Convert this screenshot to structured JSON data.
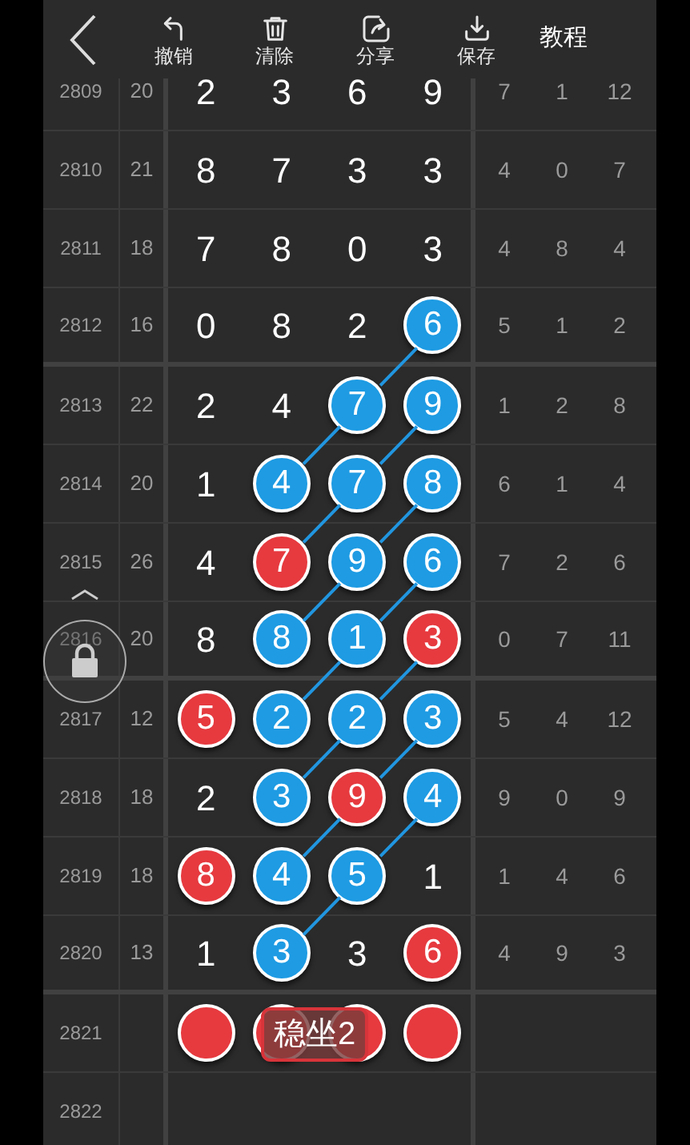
{
  "toolbar": {
    "actions": [
      {
        "kind": "undo",
        "label": "撤销"
      },
      {
        "kind": "trash",
        "label": "清除"
      },
      {
        "kind": "share",
        "label": "分享"
      },
      {
        "kind": "save",
        "label": "保存"
      }
    ],
    "tutorial": "教程"
  },
  "rows": [
    {
      "issue": "2809",
      "sum": "20",
      "cells": [
        {
          "text": "2",
          "kind": "plain"
        },
        {
          "text": "3",
          "kind": "plain"
        },
        {
          "text": "6",
          "kind": "plain"
        },
        {
          "text": "9",
          "kind": "plain"
        }
      ],
      "stats": [
        "7",
        "1",
        "12"
      ]
    },
    {
      "issue": "2810",
      "sum": "21",
      "cells": [
        {
          "text": "8",
          "kind": "plain"
        },
        {
          "text": "7",
          "kind": "plain"
        },
        {
          "text": "3",
          "kind": "plain"
        },
        {
          "text": "3",
          "kind": "plain"
        }
      ],
      "stats": [
        "4",
        "0",
        "7"
      ]
    },
    {
      "issue": "2811",
      "sum": "18",
      "cells": [
        {
          "text": "7",
          "kind": "plain"
        },
        {
          "text": "8",
          "kind": "plain"
        },
        {
          "text": "0",
          "kind": "plain"
        },
        {
          "text": "3",
          "kind": "plain"
        }
      ],
      "stats": [
        "4",
        "8",
        "4"
      ]
    },
    {
      "issue": "2812",
      "sum": "16",
      "cells": [
        {
          "text": "0",
          "kind": "plain"
        },
        {
          "text": "8",
          "kind": "plain"
        },
        {
          "text": "2",
          "kind": "plain"
        },
        {
          "text": "6",
          "kind": "blue"
        }
      ],
      "stats": [
        "5",
        "1",
        "2"
      ]
    },
    {
      "issue": "2813",
      "sum": "22",
      "cells": [
        {
          "text": "2",
          "kind": "plain"
        },
        {
          "text": "4",
          "kind": "plain"
        },
        {
          "text": "7",
          "kind": "blue"
        },
        {
          "text": "9",
          "kind": "blue"
        }
      ],
      "stats": [
        "1",
        "2",
        "8"
      ]
    },
    {
      "issue": "2814",
      "sum": "20",
      "cells": [
        {
          "text": "1",
          "kind": "plain"
        },
        {
          "text": "4",
          "kind": "blue"
        },
        {
          "text": "7",
          "kind": "blue"
        },
        {
          "text": "8",
          "kind": "blue"
        }
      ],
      "stats": [
        "6",
        "1",
        "4"
      ]
    },
    {
      "issue": "2815",
      "sum": "26",
      "cells": [
        {
          "text": "4",
          "kind": "plain"
        },
        {
          "text": "7",
          "kind": "red"
        },
        {
          "text": "9",
          "kind": "blue"
        },
        {
          "text": "6",
          "kind": "blue"
        }
      ],
      "stats": [
        "7",
        "2",
        "6"
      ]
    },
    {
      "issue": "2816",
      "sum": "20",
      "cells": [
        {
          "text": "8",
          "kind": "plain"
        },
        {
          "text": "8",
          "kind": "blue"
        },
        {
          "text": "1",
          "kind": "blue"
        },
        {
          "text": "3",
          "kind": "red"
        }
      ],
      "stats": [
        "0",
        "7",
        "11"
      ]
    },
    {
      "issue": "2817",
      "sum": "12",
      "cells": [
        {
          "text": "5",
          "kind": "red"
        },
        {
          "text": "2",
          "kind": "blue"
        },
        {
          "text": "2",
          "kind": "blue"
        },
        {
          "text": "3",
          "kind": "blue"
        }
      ],
      "stats": [
        "5",
        "4",
        "12"
      ]
    },
    {
      "issue": "2818",
      "sum": "18",
      "cells": [
        {
          "text": "2",
          "kind": "plain"
        },
        {
          "text": "3",
          "kind": "blue"
        },
        {
          "text": "9",
          "kind": "red"
        },
        {
          "text": "4",
          "kind": "blue"
        }
      ],
      "stats": [
        "9",
        "0",
        "9"
      ]
    },
    {
      "issue": "2819",
      "sum": "18",
      "cells": [
        {
          "text": "8",
          "kind": "red"
        },
        {
          "text": "4",
          "kind": "blue"
        },
        {
          "text": "5",
          "kind": "blue"
        },
        {
          "text": "1",
          "kind": "plain"
        }
      ],
      "stats": [
        "1",
        "4",
        "6"
      ]
    },
    {
      "issue": "2820",
      "sum": "13",
      "cells": [
        {
          "text": "1",
          "kind": "plain"
        },
        {
          "text": "3",
          "kind": "blue"
        },
        {
          "text": "3",
          "kind": "plain"
        },
        {
          "text": "6",
          "kind": "red"
        }
      ],
      "stats": [
        "4",
        "9",
        "3"
      ]
    },
    {
      "issue": "2821",
      "cells": [
        {
          "kind": "red"
        },
        {
          "kind": "red"
        },
        {
          "kind": "red"
        },
        {
          "kind": "red"
        }
      ],
      "tag": "稳坐2"
    },
    {
      "issue": "2822"
    }
  ]
}
